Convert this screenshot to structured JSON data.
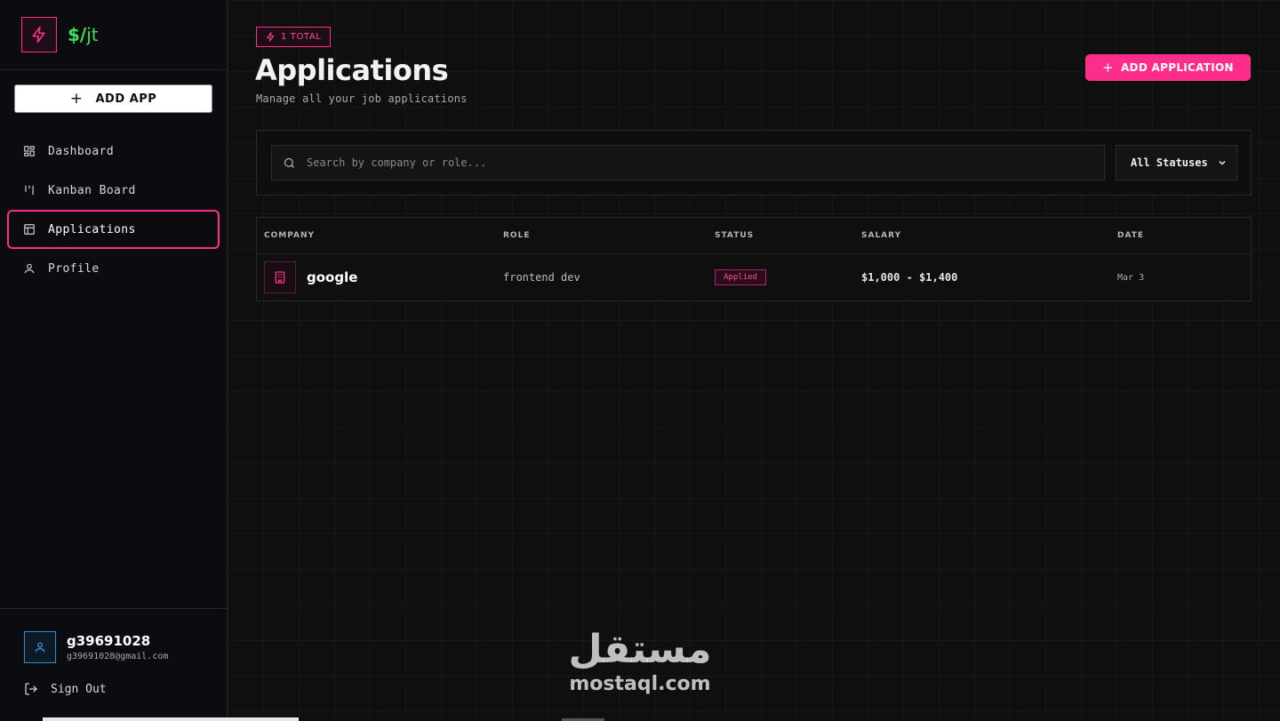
{
  "brand": {
    "name_prefix": "$/",
    "name_suffix": "jt"
  },
  "sidebar": {
    "add_app_label": "ADD APP",
    "items": [
      {
        "label": "Dashboard",
        "icon": "dashboard-icon"
      },
      {
        "label": "Kanban Board",
        "icon": "kanban-icon"
      },
      {
        "label": "Applications",
        "icon": "table-icon",
        "active": true
      },
      {
        "label": "Profile",
        "icon": "user-icon"
      }
    ]
  },
  "user": {
    "name": "g39691028",
    "email": "g39691028@gmail.com"
  },
  "signout_label": "Sign Out",
  "header": {
    "badge": "1 TOTAL",
    "title": "Applications",
    "subtitle": "Manage all your job applications",
    "add_button": "ADD APPLICATION"
  },
  "filters": {
    "search_placeholder": "Search by company or role...",
    "status_selected": "All Statuses"
  },
  "table": {
    "columns": [
      "COMPANY",
      "ROLE",
      "STATUS",
      "SALARY",
      "DATE"
    ],
    "rows": [
      {
        "company": "google",
        "role": "frontend dev",
        "status": "Applied",
        "salary": "$1,000 - $1,400",
        "date": "Mar 3"
      }
    ]
  },
  "watermark": {
    "arabic": "مستقل",
    "latin": "mostaql.com"
  },
  "colors": {
    "accent": "#ff2d8a",
    "brand_green": "#39e05c",
    "background": "#0f0f10"
  }
}
